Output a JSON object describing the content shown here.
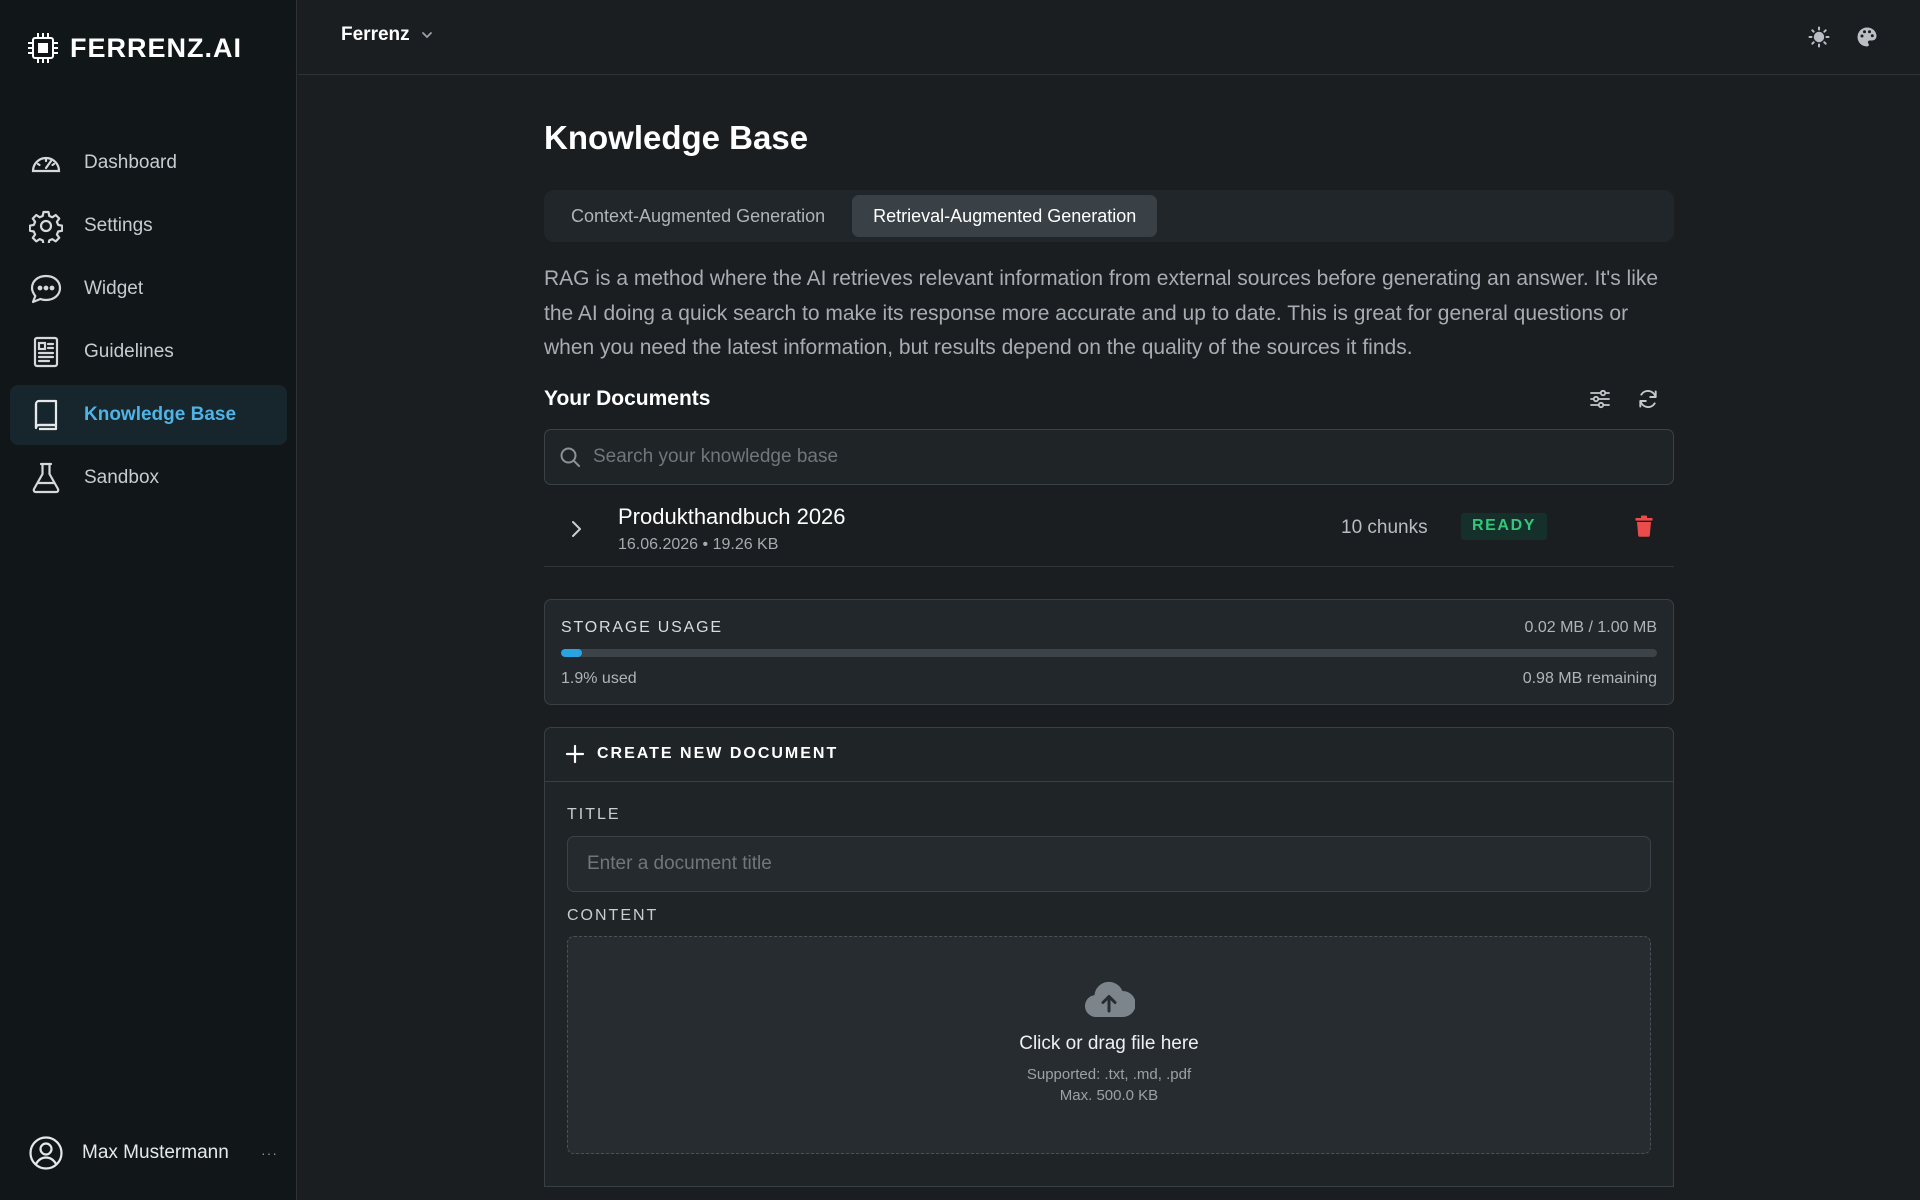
{
  "brand": {
    "name": "FERRENZ.AI",
    "icon": "chip-icon"
  },
  "sidebar": {
    "items": [
      {
        "label": "Dashboard",
        "icon": "gauge-icon",
        "active": false
      },
      {
        "label": "Settings",
        "icon": "gear-icon",
        "active": false
      },
      {
        "label": "Widget",
        "icon": "chat-bubble-icon",
        "active": false
      },
      {
        "label": "Guidelines",
        "icon": "document-icon",
        "active": false
      },
      {
        "label": "Knowledge Base",
        "icon": "book-icon",
        "active": true
      },
      {
        "label": "Sandbox",
        "icon": "flask-icon",
        "active": false
      }
    ],
    "user": {
      "name": "Max Mustermann",
      "more": "···"
    }
  },
  "topbar": {
    "org": "Ferrenz",
    "icons": [
      "sun-icon",
      "palette-icon"
    ]
  },
  "main": {
    "title": "Knowledge Base",
    "tabs": [
      {
        "label": "Context-Augmented Generation",
        "active": false
      },
      {
        "label": "Retrieval-Augmented Generation",
        "active": true
      }
    ],
    "description": "RAG is a method where the AI retrieves relevant information from external sources before generating an answer. It's like the AI doing a quick search to make its response more accurate and up to date. This is great for general questions or when you need the latest information, but results depend on the quality of the sources it finds.",
    "documents": {
      "title": "Your Documents",
      "search_placeholder": "Search your knowledge base",
      "items": [
        {
          "name": "Produkthandbuch 2026",
          "meta": "16.06.2026 • 19.26 KB",
          "chunks": "10 chunks",
          "status": "READY"
        }
      ]
    },
    "storage": {
      "label": "STORAGE USAGE",
      "value": "0.02 MB / 1.00 MB",
      "used_text": "1.9% used",
      "remaining": "0.98 MB remaining",
      "percent": 1.9
    },
    "create": {
      "title": "CREATE NEW DOCUMENT",
      "title_label": "TITLE",
      "title_placeholder": "Enter a document title",
      "content_label": "CONTENT",
      "drop_main": "Click or drag file here",
      "drop_supported": "Supported: .txt, .md, .pdf",
      "drop_max": "Max. 500.0 KB"
    }
  },
  "colors": {
    "accent": "#4fb3e6",
    "ready": "#34c77b",
    "danger": "#ea4b4b",
    "bar": "#2aa3e3"
  }
}
